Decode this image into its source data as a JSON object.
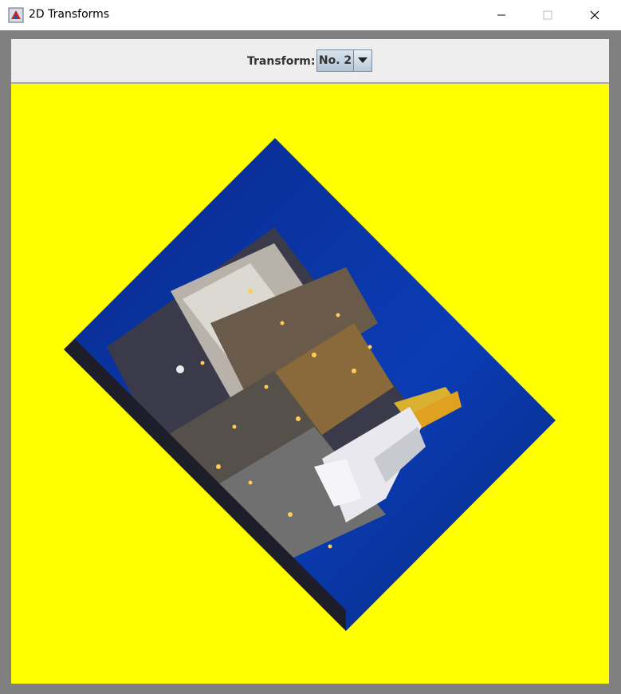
{
  "window": {
    "title": "2D Transforms",
    "icon": "java-app-icon",
    "controls": [
      "minimize-icon",
      "maximize-icon",
      "close-icon"
    ]
  },
  "toolbar": {
    "transform_label": "Transform:",
    "transform_value": "No. 2"
  },
  "canvas": {
    "background_color": "#ffff00",
    "image_subject": "space shuttle on launch pad (rotated)"
  }
}
